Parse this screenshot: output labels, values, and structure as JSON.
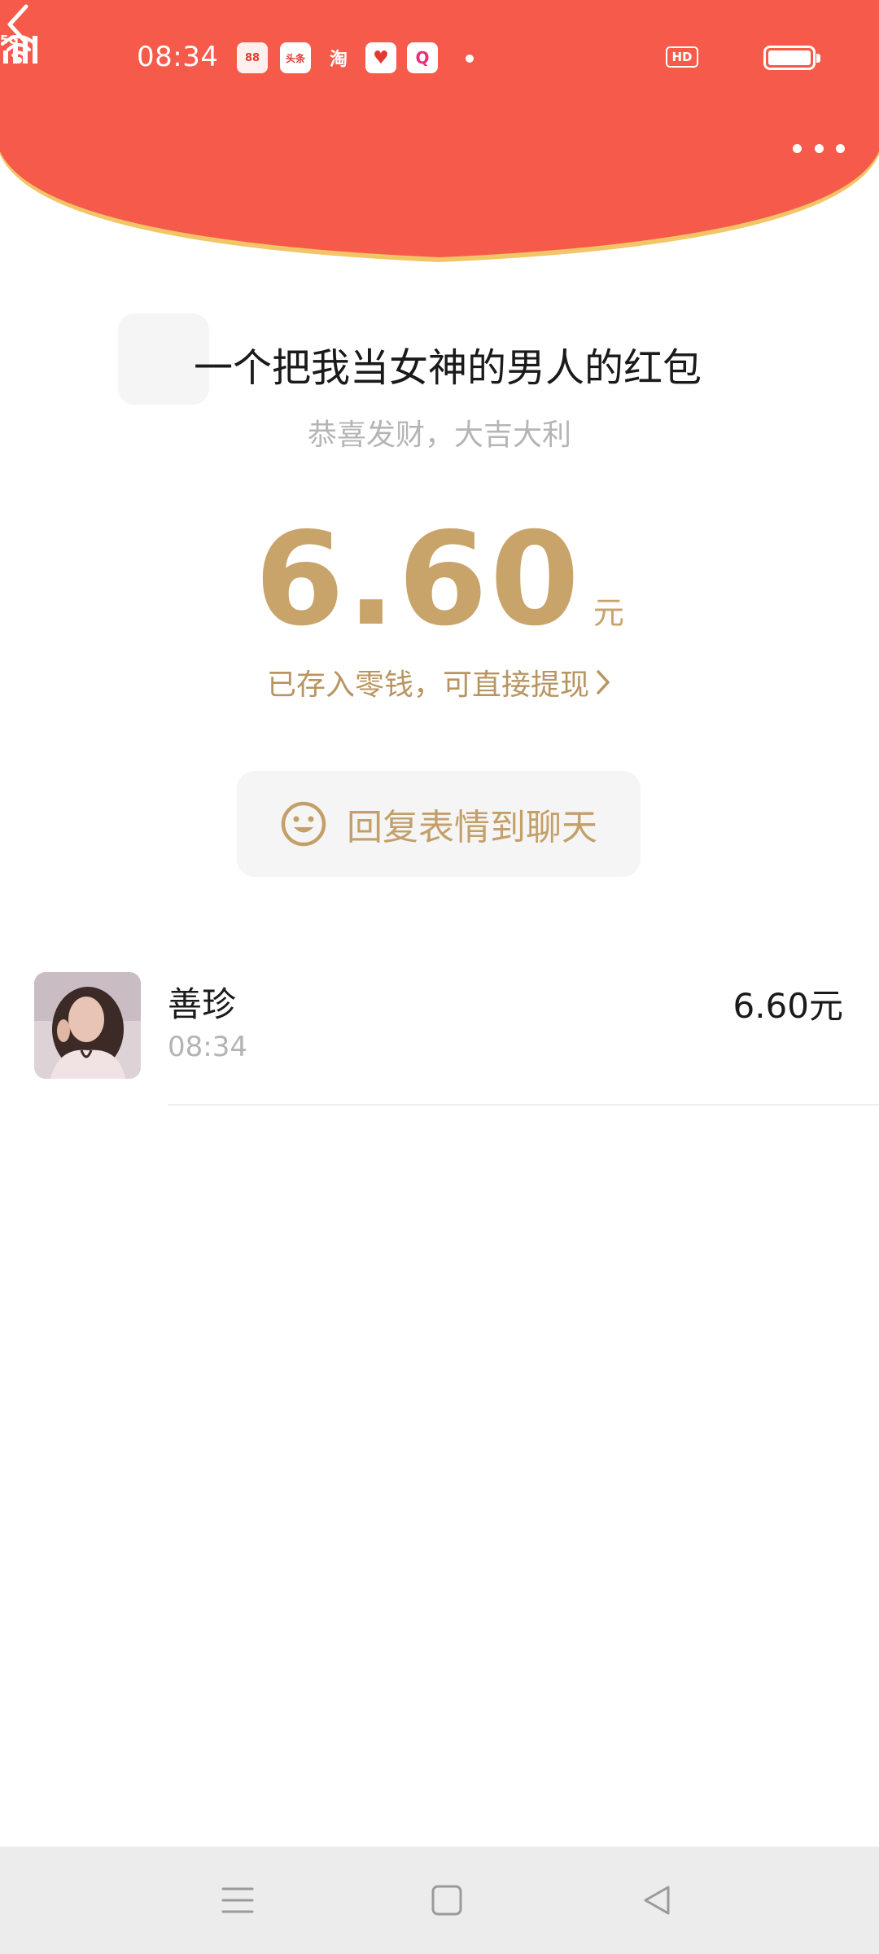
{
  "status_bar": {
    "time": "08:34",
    "notification_icons": [
      {
        "name": "shopping-app-icon",
        "text": "88"
      },
      {
        "name": "toutiao-icon",
        "text": "头条"
      },
      {
        "name": "taobao-icon",
        "text": "淘"
      },
      {
        "name": "game-app-icon",
        "text": "♥"
      },
      {
        "name": "chat-app-icon",
        "text": "Q"
      }
    ],
    "network_label": "HD",
    "signal_label": "5G"
  },
  "colors": {
    "header_red": "#f65a4a",
    "header_rim": "#f2c567",
    "gold": "#c8a46a"
  },
  "envelope": {
    "sender_title": "一个把我当女神的男人的红包",
    "blessing": "恭喜发财，大吉大利",
    "amount": "6.60",
    "unit": "元",
    "wallet_link": "已存入零钱，可直接提现"
  },
  "reply_button": {
    "label": "回复表情到聊天"
  },
  "records": [
    {
      "name": "善珍",
      "time": "08:34",
      "amount": "6.60元"
    }
  ]
}
